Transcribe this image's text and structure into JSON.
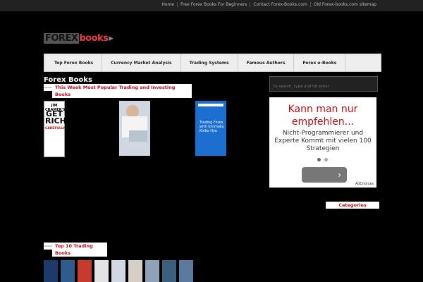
{
  "topbar": {
    "links": [
      "Home",
      "Free Forex Books For Beginners",
      "Contact Forex-Books.com",
      "Old Forex-books.com sitemap"
    ]
  },
  "logo": {
    "part1": "FOREX",
    "part2": "books"
  },
  "nav": {
    "items": [
      "Top Forex Books",
      "Currency Market Analysis",
      "Trading Systems",
      "Famous Authors",
      "Forex e-Books"
    ]
  },
  "main": {
    "title": "Forex Books",
    "popular_heading": "This Week Most Popular Trading and Investing Books",
    "top10_heading": "Top 10 Trading Books",
    "books": [
      {
        "author": "JIM CRAMER'S",
        "title": "GET RICH",
        "subtitle": "CAREFULLY"
      },
      {},
      {
        "title": "Trading Forex with Ichimoku Kinko Hyo"
      }
    ]
  },
  "sidebar": {
    "search_placeholder": "to search, type and hit enter",
    "ad": {
      "headline": "Kann man nur empfehlen...",
      "body": "Nicht-Programmierer und Experte Kommt mit vielen 100 Strategien",
      "button": "›",
      "adchoices": "AdChoices"
    },
    "categories_heading": "Categories"
  },
  "colors": {
    "accent": "#b5121b",
    "logo_red": "#e84141"
  }
}
